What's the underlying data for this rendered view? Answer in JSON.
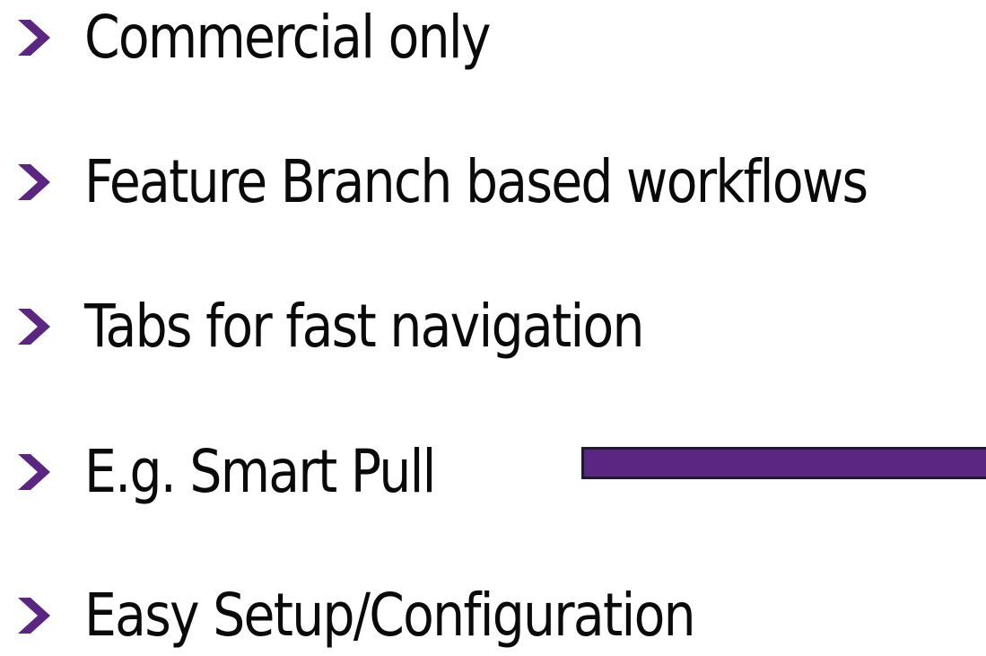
{
  "slide": {
    "bullets": [
      {
        "label": "Commercial only"
      },
      {
        "label": "Feature Branch based workflows"
      },
      {
        "label": "Tabs for fast navigation"
      },
      {
        "label": "E.g. Smart Pull"
      },
      {
        "label": "Easy Setup/Configuration"
      }
    ],
    "bullet_icon": "chevron-right-icon",
    "colors": {
      "accent": "#5b2681",
      "text": "#0a0a0a",
      "bar_border": "#1b1b2e",
      "background": "#ffffff"
    }
  }
}
